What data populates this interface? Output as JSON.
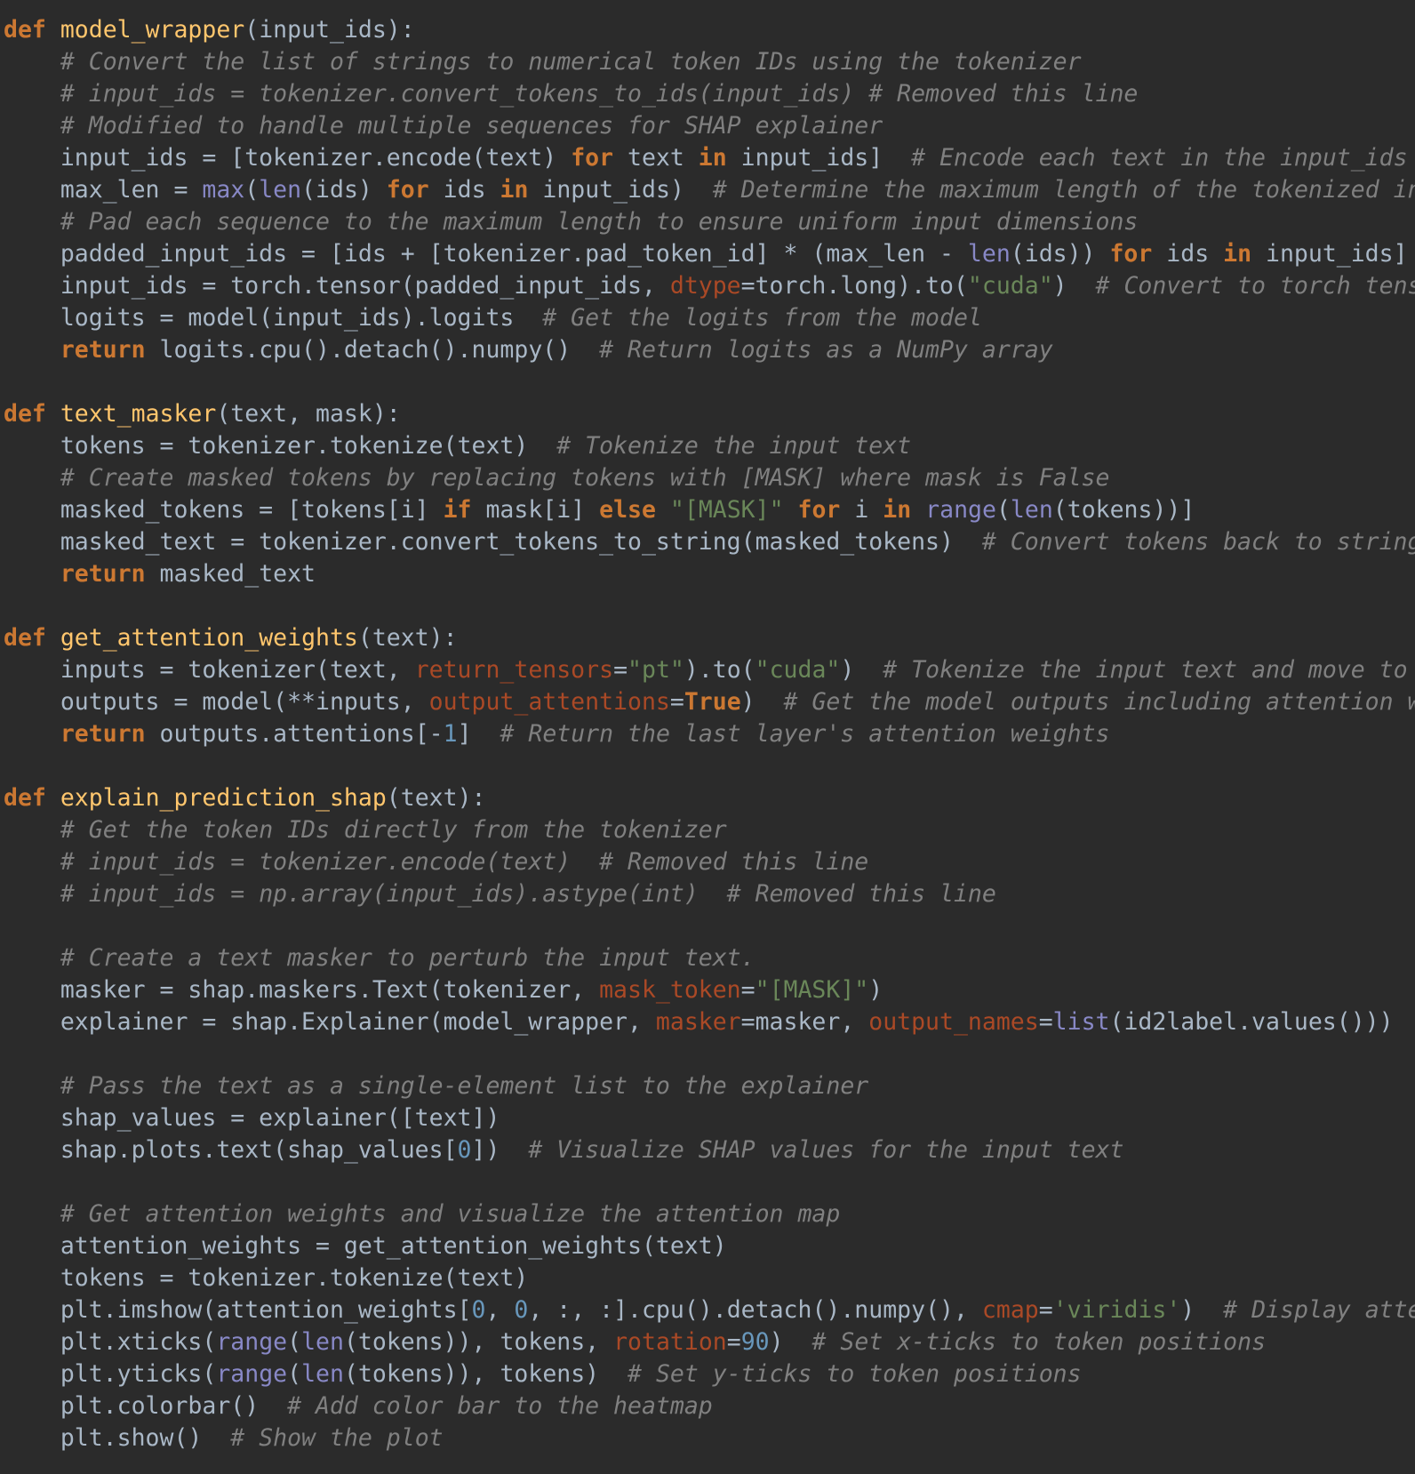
{
  "theme": {
    "background": "#2b2b2b",
    "default": "#a9b7c6",
    "keyword": "#cc7832",
    "function_name": "#ffc66d",
    "comment": "#808080",
    "builtin": "#8888c6",
    "string": "#6a8759",
    "number": "#6897bb",
    "keyword_argument": "#aa4926"
  },
  "lines": [
    [
      [
        "kw",
        "def"
      ],
      [
        "pl",
        " "
      ],
      [
        "fn",
        "model_wrapper"
      ],
      [
        "pl",
        "(input_ids):"
      ]
    ],
    [
      [
        "pl",
        "    "
      ],
      [
        "cm",
        "# Convert the list of strings to numerical token IDs using the tokenizer"
      ]
    ],
    [
      [
        "pl",
        "    "
      ],
      [
        "cm",
        "# input_ids = tokenizer.convert_tokens_to_ids(input_ids) # Removed this line"
      ]
    ],
    [
      [
        "pl",
        "    "
      ],
      [
        "cm",
        "# Modified to handle multiple sequences for SHAP explainer"
      ]
    ],
    [
      [
        "pl",
        "    input_ids = [tokenizer.encode(text) "
      ],
      [
        "kw",
        "for"
      ],
      [
        "pl",
        " text "
      ],
      [
        "kw",
        "in"
      ],
      [
        "pl",
        " input_ids]  "
      ],
      [
        "cm",
        "# Encode each text in the input_ids li"
      ]
    ],
    [
      [
        "pl",
        "    max_len = "
      ],
      [
        "bi",
        "max"
      ],
      [
        "pl",
        "("
      ],
      [
        "bi",
        "len"
      ],
      [
        "pl",
        "(ids) "
      ],
      [
        "kw",
        "for"
      ],
      [
        "pl",
        " ids "
      ],
      [
        "kw",
        "in"
      ],
      [
        "pl",
        " input_ids)  "
      ],
      [
        "cm",
        "# Determine the maximum length of the tokenized inpu"
      ]
    ],
    [
      [
        "pl",
        "    "
      ],
      [
        "cm",
        "# Pad each sequence to the maximum length to ensure uniform input dimensions"
      ]
    ],
    [
      [
        "pl",
        "    padded_input_ids = [ids + [tokenizer.pad_token_id] * (max_len - "
      ],
      [
        "bi",
        "len"
      ],
      [
        "pl",
        "(ids)) "
      ],
      [
        "kw",
        "for"
      ],
      [
        "pl",
        " ids "
      ],
      [
        "kw",
        "in"
      ],
      [
        "pl",
        " input_ids]"
      ]
    ],
    [
      [
        "pl",
        "    input_ids = torch.tensor(padded_input_ids, "
      ],
      [
        "kwa",
        "dtype"
      ],
      [
        "pl",
        "=torch.long).to("
      ],
      [
        "str",
        "\"cuda\""
      ],
      [
        "pl",
        ")  "
      ],
      [
        "cm",
        "# Convert to torch tensor"
      ]
    ],
    [
      [
        "pl",
        "    logits = model(input_ids).logits  "
      ],
      [
        "cm",
        "# Get the logits from the model"
      ]
    ],
    [
      [
        "pl",
        "    "
      ],
      [
        "kw",
        "return"
      ],
      [
        "pl",
        " logits.cpu().detach().numpy()  "
      ],
      [
        "cm",
        "# Return logits as a NumPy array"
      ]
    ],
    [],
    [
      [
        "kw",
        "def"
      ],
      [
        "pl",
        " "
      ],
      [
        "fn",
        "text_masker"
      ],
      [
        "pl",
        "(text, mask):"
      ]
    ],
    [
      [
        "pl",
        "    tokens = tokenizer.tokenize(text)  "
      ],
      [
        "cm",
        "# Tokenize the input text"
      ]
    ],
    [
      [
        "pl",
        "    "
      ],
      [
        "cm",
        "# Create masked tokens by replacing tokens with [MASK] where mask is False"
      ]
    ],
    [
      [
        "pl",
        "    masked_tokens = [tokens[i] "
      ],
      [
        "kw",
        "if"
      ],
      [
        "pl",
        " mask[i] "
      ],
      [
        "kw",
        "else"
      ],
      [
        "pl",
        " "
      ],
      [
        "str",
        "\"[MASK]\""
      ],
      [
        "pl",
        " "
      ],
      [
        "kw",
        "for"
      ],
      [
        "pl",
        " i "
      ],
      [
        "kw",
        "in"
      ],
      [
        "pl",
        " "
      ],
      [
        "bi",
        "range"
      ],
      [
        "pl",
        "("
      ],
      [
        "bi",
        "len"
      ],
      [
        "pl",
        "(tokens))]"
      ]
    ],
    [
      [
        "pl",
        "    masked_text = tokenizer.convert_tokens_to_string(masked_tokens)  "
      ],
      [
        "cm",
        "# Convert tokens back to string"
      ]
    ],
    [
      [
        "pl",
        "    "
      ],
      [
        "kw",
        "return"
      ],
      [
        "pl",
        " masked_text"
      ]
    ],
    [],
    [
      [
        "kw",
        "def"
      ],
      [
        "pl",
        " "
      ],
      [
        "fn",
        "get_attention_weights"
      ],
      [
        "pl",
        "(text):"
      ]
    ],
    [
      [
        "pl",
        "    inputs = tokenizer(text, "
      ],
      [
        "kwa",
        "return_tensors"
      ],
      [
        "pl",
        "="
      ],
      [
        "str",
        "\"pt\""
      ],
      [
        "pl",
        ").to("
      ],
      [
        "str",
        "\"cuda\""
      ],
      [
        "pl",
        ")  "
      ],
      [
        "cm",
        "# Tokenize the input text and move to GP"
      ]
    ],
    [
      [
        "pl",
        "    outputs = model(**inputs, "
      ],
      [
        "kwa",
        "output_attentions"
      ],
      [
        "pl",
        "="
      ],
      [
        "kw",
        "True"
      ],
      [
        "pl",
        ")  "
      ],
      [
        "cm",
        "# Get the model outputs including attention wei"
      ]
    ],
    [
      [
        "pl",
        "    "
      ],
      [
        "kw",
        "return"
      ],
      [
        "pl",
        " outputs.attentions[-"
      ],
      [
        "num",
        "1"
      ],
      [
        "pl",
        "]  "
      ],
      [
        "cm",
        "# Return the last layer's attention weights"
      ]
    ],
    [],
    [
      [
        "kw",
        "def"
      ],
      [
        "pl",
        " "
      ],
      [
        "fn",
        "explain_prediction_shap"
      ],
      [
        "pl",
        "(text):"
      ]
    ],
    [
      [
        "pl",
        "    "
      ],
      [
        "cm",
        "# Get the token IDs directly from the tokenizer"
      ]
    ],
    [
      [
        "pl",
        "    "
      ],
      [
        "cm",
        "# input_ids = tokenizer.encode(text)  # Removed this line"
      ]
    ],
    [
      [
        "pl",
        "    "
      ],
      [
        "cm",
        "# input_ids = np.array(input_ids).astype(int)  # Removed this line"
      ]
    ],
    [],
    [
      [
        "pl",
        "    "
      ],
      [
        "cm",
        "# Create a text masker to perturb the input text."
      ]
    ],
    [
      [
        "pl",
        "    masker = shap.maskers.Text(tokenizer, "
      ],
      [
        "kwa",
        "mask_token"
      ],
      [
        "pl",
        "="
      ],
      [
        "str",
        "\"[MASK]\""
      ],
      [
        "pl",
        ")"
      ]
    ],
    [
      [
        "pl",
        "    explainer = shap.Explainer(model_wrapper, "
      ],
      [
        "kwa",
        "masker"
      ],
      [
        "pl",
        "=masker, "
      ],
      [
        "kwa",
        "output_names"
      ],
      [
        "pl",
        "="
      ],
      [
        "bi",
        "list"
      ],
      [
        "pl",
        "(id2label.values()))  "
      ],
      [
        "cm",
        "#"
      ]
    ],
    [],
    [
      [
        "pl",
        "    "
      ],
      [
        "cm",
        "# Pass the text as a single-element list to the explainer"
      ]
    ],
    [
      [
        "pl",
        "    shap_values = explainer([text])"
      ]
    ],
    [
      [
        "pl",
        "    shap.plots.text(shap_values["
      ],
      [
        "num",
        "0"
      ],
      [
        "pl",
        "])  "
      ],
      [
        "cm",
        "# Visualize SHAP values for the input text"
      ]
    ],
    [],
    [
      [
        "pl",
        "    "
      ],
      [
        "cm",
        "# Get attention weights and visualize the attention map"
      ]
    ],
    [
      [
        "pl",
        "    attention_weights = get_attention_weights(text)"
      ]
    ],
    [
      [
        "pl",
        "    tokens = tokenizer.tokenize(text)"
      ]
    ],
    [
      [
        "pl",
        "    plt.imshow(attention_weights["
      ],
      [
        "num",
        "0"
      ],
      [
        "pl",
        ", "
      ],
      [
        "num",
        "0"
      ],
      [
        "pl",
        ", :, :].cpu().detach().numpy(), "
      ],
      [
        "kwa",
        "cmap"
      ],
      [
        "pl",
        "="
      ],
      [
        "str",
        "'viridis'"
      ],
      [
        "pl",
        ")  "
      ],
      [
        "cm",
        "# Display attent"
      ]
    ],
    [
      [
        "pl",
        "    plt.xticks("
      ],
      [
        "bi",
        "range"
      ],
      [
        "pl",
        "("
      ],
      [
        "bi",
        "len"
      ],
      [
        "pl",
        "(tokens)), tokens, "
      ],
      [
        "kwa",
        "rotation"
      ],
      [
        "pl",
        "="
      ],
      [
        "num",
        "90"
      ],
      [
        "pl",
        ")  "
      ],
      [
        "cm",
        "# Set x-ticks to token positions"
      ]
    ],
    [
      [
        "pl",
        "    plt.yticks("
      ],
      [
        "bi",
        "range"
      ],
      [
        "pl",
        "("
      ],
      [
        "bi",
        "len"
      ],
      [
        "pl",
        "(tokens)), tokens)  "
      ],
      [
        "cm",
        "# Set y-ticks to token positions"
      ]
    ],
    [
      [
        "pl",
        "    plt.colorbar()  "
      ],
      [
        "cm",
        "# Add color bar to the heatmap"
      ]
    ],
    [
      [
        "pl",
        "    plt.show()  "
      ],
      [
        "cm",
        "# Show the plot"
      ]
    ]
  ]
}
